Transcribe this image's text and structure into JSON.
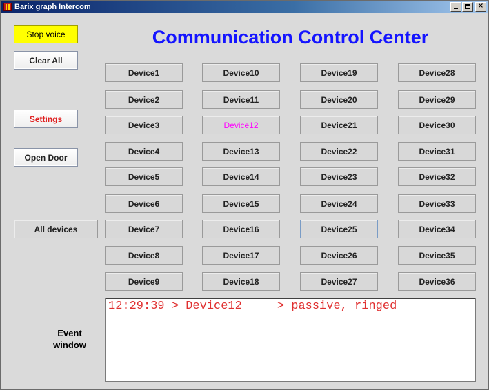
{
  "window": {
    "title": "Barix graph Intercom",
    "controls": {
      "minimize": "_",
      "maximize": "□",
      "close": "×"
    }
  },
  "heading": "Communication Control Center",
  "side_buttons": {
    "stop_voice": "Stop voice",
    "clear_all": "Clear All",
    "settings": "Settings",
    "open_door": "Open Door",
    "all_devices": "All devices"
  },
  "devices": [
    "Device1",
    "Device2",
    "Device3",
    "Device4",
    "Device5",
    "Device6",
    "Device7",
    "Device8",
    "Device9",
    "Device10",
    "Device11",
    "Device12",
    "Device13",
    "Device14",
    "Device15",
    "Device16",
    "Device17",
    "Device18",
    "Device19",
    "Device20",
    "Device21",
    "Device22",
    "Device23",
    "Device24",
    "Device25",
    "Device26",
    "Device27",
    "Device28",
    "Device29",
    "Device30",
    "Device31",
    "Device32",
    "Device33",
    "Device34",
    "Device35",
    "Device36"
  ],
  "active_device": "Device12",
  "focused_device": "Device25",
  "event_label": {
    "line1": "Event",
    "line2": "window"
  },
  "events": [
    "12:29:39 > Device12     > passive, ringed"
  ],
  "colors": {
    "heading": "#1414ff",
    "stop_voice_bg": "#ffff00",
    "settings_text": "#e02020",
    "active_device_text": "#ff00ff",
    "event_text": "#e03030"
  }
}
